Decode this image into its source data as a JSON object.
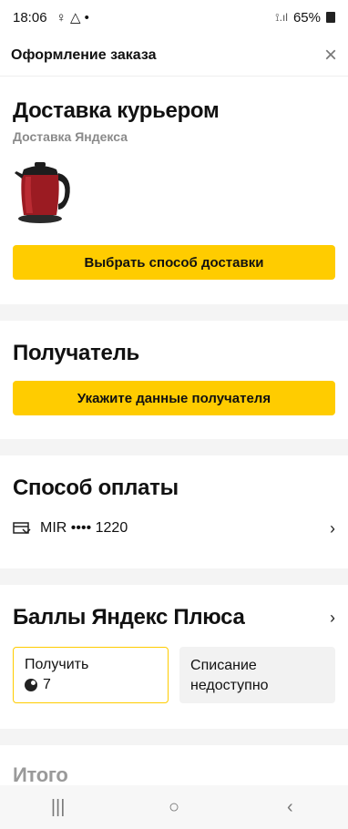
{
  "status_bar": {
    "time": "18:06",
    "left_icons": "♀ △ •",
    "signal_label": "⟟.ıl",
    "battery": "65%"
  },
  "header": {
    "title": "Оформление заказа",
    "close_icon": "×"
  },
  "delivery": {
    "title": "Доставка курьером",
    "provider": "Доставка Яндекса",
    "product_image": "red-electric-kettle",
    "button_label": "Выбрать способ доставки"
  },
  "recipient": {
    "title": "Получатель",
    "button_label": "Укажите данные получателя"
  },
  "payment": {
    "title": "Способ оплаты",
    "card_label": "MIR •••• 1220",
    "chevron": "›"
  },
  "plus_points": {
    "title": "Баллы Яндекс Плюса",
    "chevron": "›",
    "earn_label": "Получить",
    "earn_value": "7",
    "spend_label": "Списание недоступно"
  },
  "total": {
    "title": "Итого"
  },
  "nav": {
    "recents": "|||",
    "home": "○",
    "back": "‹"
  },
  "colors": {
    "accent": "#ffcc00",
    "divider": "#f4f4f4"
  }
}
